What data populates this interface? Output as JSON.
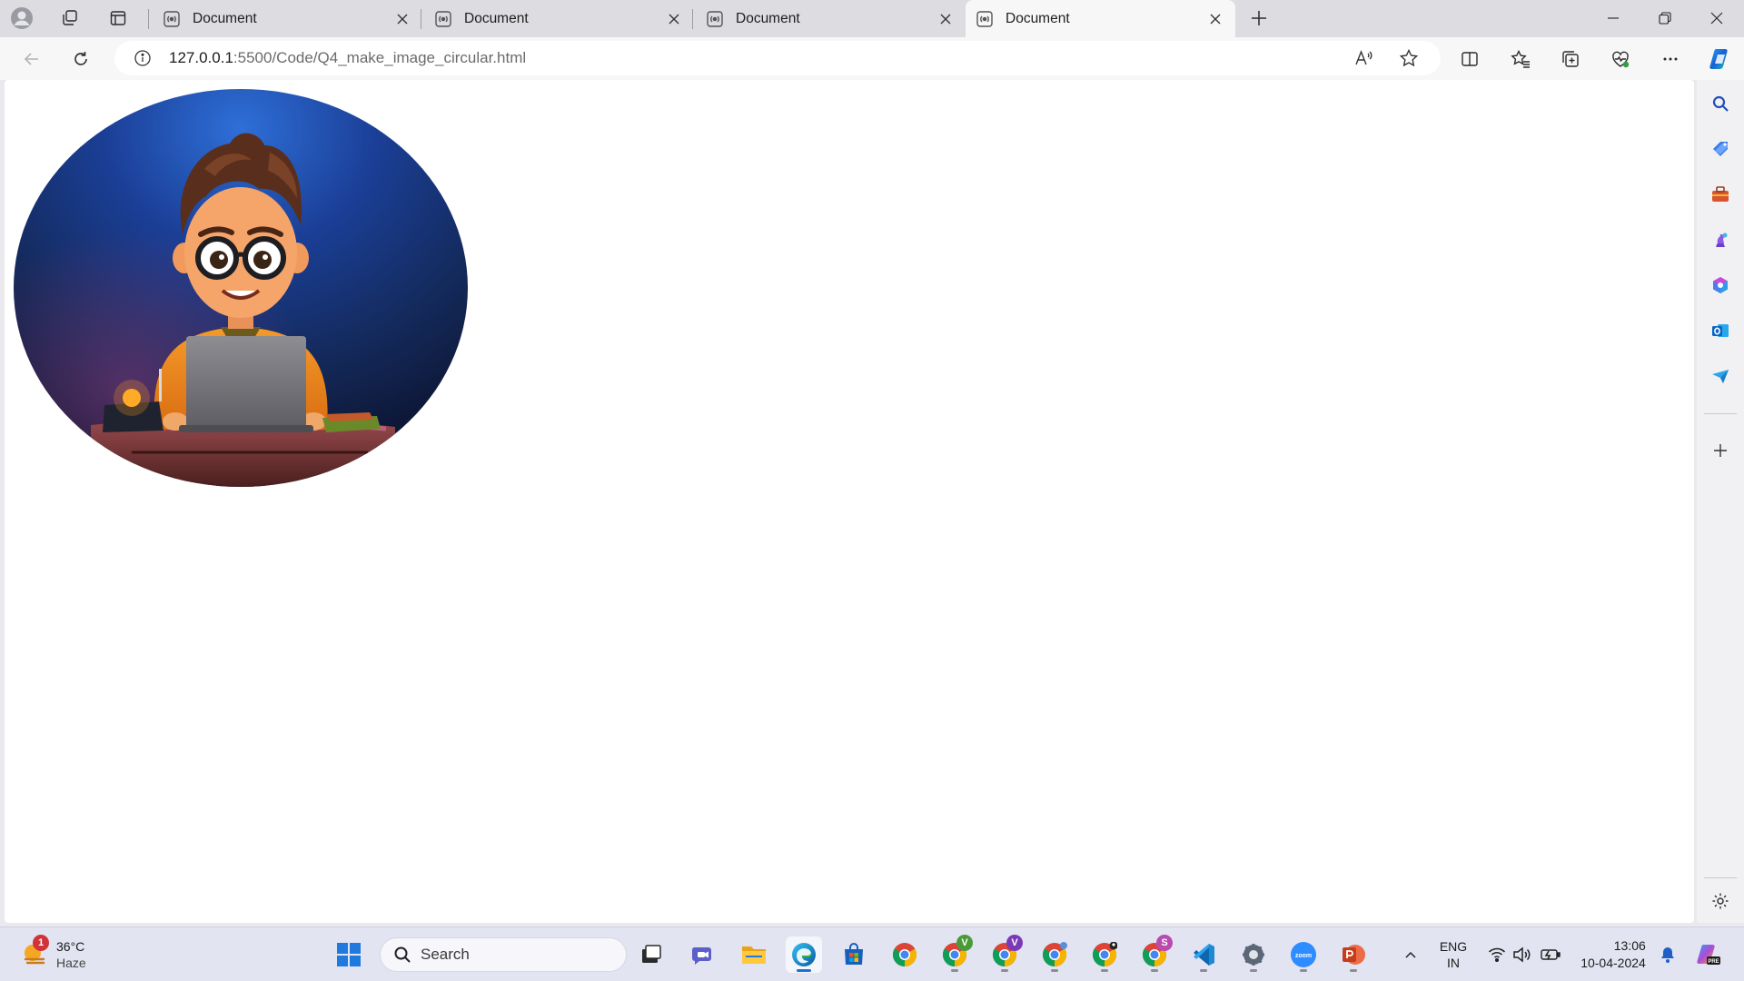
{
  "browser": {
    "tabs": [
      {
        "title": "Document",
        "active": false
      },
      {
        "title": "Document",
        "active": false
      },
      {
        "title": "Document",
        "active": false
      },
      {
        "title": "Document",
        "active": true
      }
    ],
    "address": {
      "host": "127.0.0.1",
      "path": ":5500/Code/Q4_make_image_circular.html"
    }
  },
  "page": {
    "image_icon": "cartoon-developer-with-laptop-image"
  },
  "taskbar": {
    "weather": {
      "badge": "1",
      "temp": "36°C",
      "condition": "Haze"
    },
    "search_label": "Search",
    "language": {
      "line1": "ENG",
      "line2": "IN"
    },
    "clock": {
      "time": "13:06",
      "date": "10-04-2024"
    },
    "profile_badges": [
      "V",
      "V",
      "",
      "",
      "S"
    ]
  },
  "colors": {
    "accent": "#1a6fd4",
    "chrome_bg": "#dcdce1",
    "toolbar_bg": "#f7f7f7",
    "taskbar_bg": "#e2e4f1"
  }
}
